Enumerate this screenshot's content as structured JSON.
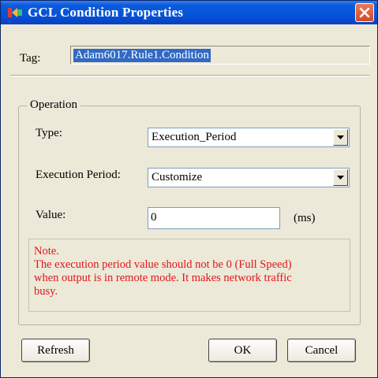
{
  "window": {
    "title": "GCL Condition Properties"
  },
  "tag": {
    "label": "Tag:",
    "value": "Adam6017.Rule1.Condition"
  },
  "operation": {
    "group_title": "Operation",
    "type_label": "Type:",
    "type_value": "Execution_Period",
    "period_label": "Execution Period:",
    "period_value": "Customize",
    "value_label": "Value:",
    "value_value": "0",
    "unit": "(ms)"
  },
  "note": {
    "lines": [
      "Note.",
      "The execution period value should not be 0 (Full Speed)",
      "when output is in remote mode. It makes network traffic",
      "busy."
    ]
  },
  "buttons": {
    "refresh": "Refresh",
    "ok": "OK",
    "cancel": "Cancel"
  },
  "colors": {
    "title_bar": "#0453d8",
    "note_text": "#e0161c",
    "selection": "#316ac5"
  },
  "icons": {
    "app": "gcl-app-icon",
    "close": "close-icon",
    "dropdown": "chevron-down-icon"
  }
}
